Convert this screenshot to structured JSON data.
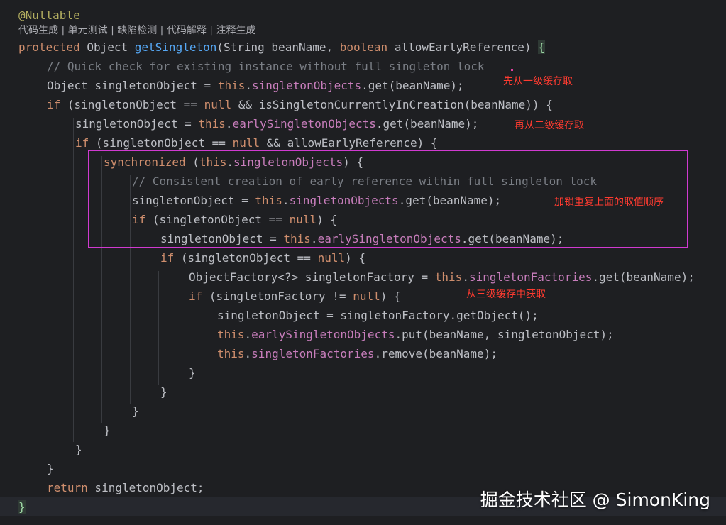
{
  "code": {
    "annotation": "@Nullable",
    "inlay_hints": "代码生成 | 单元测试 | 缺陷检测 | 代码解释 | 注释生成",
    "lines": {
      "l1": {
        "kw": "protected",
        "a": " Object ",
        "fn": "getSingleton",
        "b": "(String beanName, ",
        "kw2": "boolean",
        "c": " allowEarlyReference) ",
        "brace": "{"
      },
      "l2": "// Quick check for existing instance without full singleton lock",
      "l3": {
        "a": "Object singletonObject = ",
        "kw": "this",
        "b": ".",
        "fld": "singletonObjects",
        "c": ".get(beanName);"
      },
      "l4": {
        "kw": "if",
        "a": " (singletonObject == ",
        "kw2": "null",
        "b": " && isSingletonCurrentlyInCreation(beanName)) {"
      },
      "l5": {
        "a": "singletonObject = ",
        "kw": "this",
        "b": ".",
        "fld": "earlySingletonObjects",
        "c": ".get(beanName);"
      },
      "l6": {
        "kw": "if",
        "a": " (singletonObject == ",
        "kw2": "null",
        "b": " && allowEarlyReference) {"
      },
      "l7": {
        "kw": "synchronized",
        "a": " (",
        "kw2": "this",
        "b": ".",
        "fld": "singletonObjects",
        "c": ") {"
      },
      "l8": "// Consistent creation of early reference within full singleton lock",
      "l9": {
        "a": "singletonObject = ",
        "kw": "this",
        "b": ".",
        "fld": "singletonObjects",
        "c": ".get(beanName);"
      },
      "l10": {
        "kw": "if",
        "a": " (singletonObject == ",
        "kw2": "null",
        "b": ") {"
      },
      "l11": {
        "a": "singletonObject = ",
        "kw": "this",
        "b": ".",
        "fld": "earlySingletonObjects",
        "c": ".get(beanName);"
      },
      "l12": {
        "kw": "if",
        "a": " (singletonObject == ",
        "kw2": "null",
        "b": ") {"
      },
      "l13": {
        "a": "ObjectFactory<?> singletonFactory = ",
        "kw": "this",
        "b": ".",
        "fld": "singletonFactories",
        "c": ".get(beanName);"
      },
      "l14": {
        "kw": "if",
        "a": " (singletonFactory != ",
        "kw2": "null",
        "b": ") {"
      },
      "l15": "singletonObject = singletonFactory.getObject();",
      "l16": {
        "kw": "this",
        "b": ".",
        "fld": "earlySingletonObjects",
        "c": ".put(beanName, singletonObject);"
      },
      "l17": {
        "kw": "this",
        "b": ".",
        "fld": "singletonFactories",
        "c": ".remove(beanName);"
      },
      "close": "}",
      "l24": {
        "kw": "return",
        "a": " singletonObject;"
      }
    }
  },
  "notes": {
    "n1": "先从一级缓存取",
    "n2": "再从二级缓存取",
    "n3": "加锁重复上面的取值顺序",
    "n4": "从三级缓存中获取"
  },
  "watermark": "掘金技术社区 @ SimonKing",
  "colors": {
    "background": "#1e1f22",
    "keyword": "#cf8e6d",
    "method": "#56a8f5",
    "field": "#c77dbb",
    "comment": "#7a7e85",
    "annotation": "#b3ae60",
    "note_red": "#ff3b30",
    "highlight_box": "#d03ad0"
  }
}
